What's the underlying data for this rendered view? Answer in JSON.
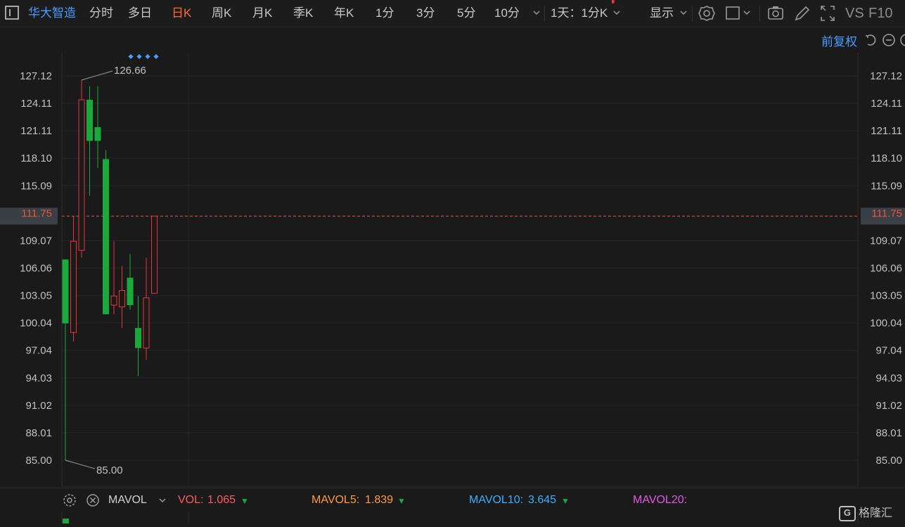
{
  "toolbar": {
    "stock_name": "华大智造",
    "periods": [
      "分时",
      "多日",
      "日K",
      "周K",
      "月K",
      "季K",
      "年K",
      "1分",
      "3分",
      "5分",
      "10分"
    ],
    "active_period": "日K",
    "interval": "1天：1分K",
    "display": "显示",
    "vs": "VS",
    "f10": "F10"
  },
  "subbar": {
    "adjust": "前复权"
  },
  "chart_data": {
    "type": "candlestick",
    "y_ticks": [
      "127.12",
      "124.11",
      "121.11",
      "118.10",
      "115.09",
      "111.75",
      "109.07",
      "106.06",
      "103.05",
      "100.04",
      "97.04",
      "94.03",
      "91.02",
      "88.01",
      "85.00"
    ],
    "current_price": "111.75",
    "high_label": "126.66",
    "low_label": "85.00",
    "ylim": [
      85.0,
      127.12
    ],
    "colors": {
      "up": "#e8343b",
      "down": "#1aaa3b",
      "price_line": "#e8553b"
    },
    "candles": [
      {
        "open": 107.0,
        "close": 100.0,
        "high": 107.0,
        "low": 85.0
      },
      {
        "open": 99.0,
        "close": 109.0,
        "high": 111.75,
        "low": 98.0
      },
      {
        "open": 108.0,
        "close": 124.5,
        "high": 126.66,
        "low": 107.2
      },
      {
        "open": 124.5,
        "close": 120.0,
        "high": 126.0,
        "low": 114.0
      },
      {
        "open": 121.5,
        "close": 120.0,
        "high": 126.0,
        "low": 117.0
      },
      {
        "open": 118.0,
        "close": 101.0,
        "high": 119.0,
        "low": 101.0
      },
      {
        "open": 102.0,
        "close": 103.0,
        "high": 109.0,
        "low": 101.0
      },
      {
        "open": 101.8,
        "close": 103.6,
        "high": 106.3,
        "low": 99.5
      },
      {
        "open": 105.0,
        "close": 102.0,
        "high": 107.6,
        "low": 101.5
      },
      {
        "open": 99.5,
        "close": 97.3,
        "high": 103.0,
        "low": 94.2
      },
      {
        "open": 97.3,
        "close": 102.8,
        "high": 107.2,
        "low": 96.0
      },
      {
        "open": 103.3,
        "close": 111.75,
        "high": 111.75,
        "low": 103.3
      }
    ]
  },
  "footer": {
    "indicator": "MAVOL",
    "vol_label": "VOL:",
    "vol_value": "1.065",
    "mavol5_label": "MAVOL5:",
    "mavol5_value": "1.839",
    "mavol10_label": "MAVOL10:",
    "mavol10_value": "3.645",
    "mavol20_label": "MAVOL20:",
    "colors": {
      "vol": "#ff5a5a",
      "mavol5": "#ff9a3b",
      "mavol10": "#3bb0ff",
      "mavol20": "#e05ae0"
    }
  },
  "watermark": "格隆汇"
}
